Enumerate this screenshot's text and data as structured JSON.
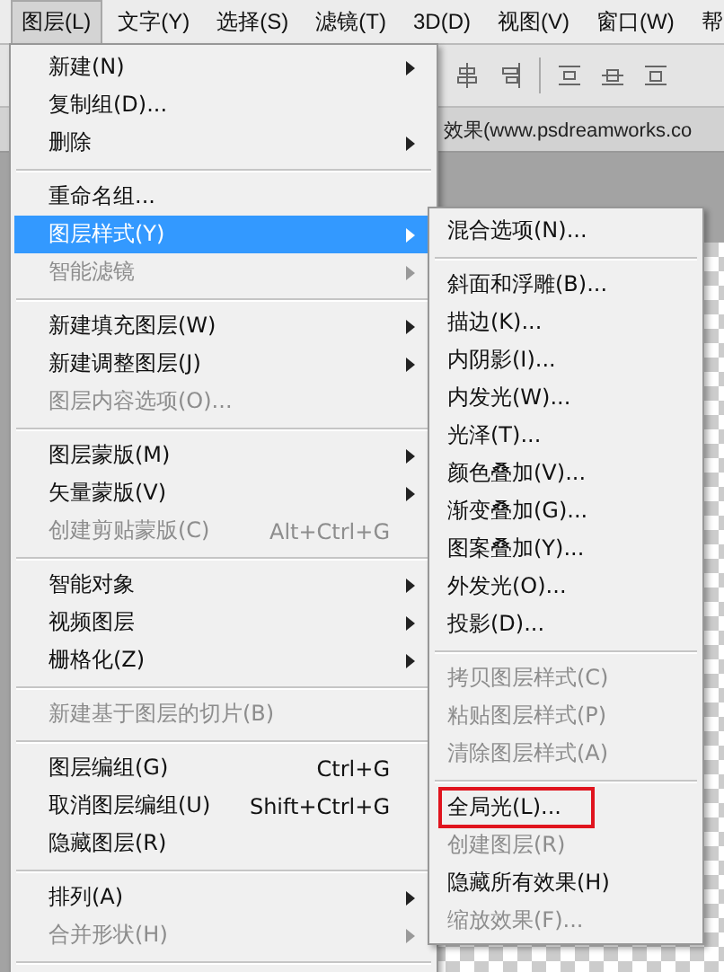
{
  "menubar": [
    {
      "label": "图层(L)",
      "selected": true
    },
    {
      "label": "文字(Y)",
      "selected": false
    },
    {
      "label": "选择(S)",
      "selected": false
    },
    {
      "label": "滤镜(T)",
      "selected": false
    },
    {
      "label": "3D(D)",
      "selected": false
    },
    {
      "label": "视图(V)",
      "selected": false
    },
    {
      "label": "窗口(W)",
      "selected": false
    },
    {
      "label": "帮",
      "selected": false
    }
  ],
  "document_tab": {
    "title": "效果(www.psdreamworks.co"
  },
  "menu": {
    "items": [
      {
        "kind": "item",
        "label": "新建(N)",
        "submenu": true,
        "disabled": false,
        "selected": false
      },
      {
        "kind": "item",
        "label": "复制组(D)...",
        "submenu": false,
        "disabled": false,
        "selected": false
      },
      {
        "kind": "item",
        "label": "删除",
        "submenu": true,
        "disabled": false,
        "selected": false
      },
      {
        "kind": "separator"
      },
      {
        "kind": "item",
        "label": "重命名组...",
        "submenu": false,
        "disabled": false,
        "selected": false
      },
      {
        "kind": "item",
        "label": "图层样式(Y)",
        "submenu": true,
        "disabled": false,
        "selected": true
      },
      {
        "kind": "item",
        "label": "智能滤镜",
        "submenu": true,
        "disabled": true,
        "selected": false
      },
      {
        "kind": "separator"
      },
      {
        "kind": "item",
        "label": "新建填充图层(W)",
        "submenu": true,
        "disabled": false,
        "selected": false
      },
      {
        "kind": "item",
        "label": "新建调整图层(J)",
        "submenu": true,
        "disabled": false,
        "selected": false
      },
      {
        "kind": "item",
        "label": "图层内容选项(O)...",
        "submenu": false,
        "disabled": true,
        "selected": false
      },
      {
        "kind": "separator"
      },
      {
        "kind": "item",
        "label": "图层蒙版(M)",
        "submenu": true,
        "disabled": false,
        "selected": false
      },
      {
        "kind": "item",
        "label": "矢量蒙版(V)",
        "submenu": true,
        "disabled": false,
        "selected": false
      },
      {
        "kind": "item",
        "label": "创建剪贴蒙版(C)",
        "shortcut": "Alt+Ctrl+G",
        "submenu": false,
        "disabled": true,
        "selected": false
      },
      {
        "kind": "separator"
      },
      {
        "kind": "item",
        "label": "智能对象",
        "submenu": true,
        "disabled": false,
        "selected": false
      },
      {
        "kind": "item",
        "label": "视频图层",
        "submenu": true,
        "disabled": false,
        "selected": false
      },
      {
        "kind": "item",
        "label": "栅格化(Z)",
        "submenu": true,
        "disabled": false,
        "selected": false
      },
      {
        "kind": "separator"
      },
      {
        "kind": "item",
        "label": "新建基于图层的切片(B)",
        "submenu": false,
        "disabled": true,
        "selected": false
      },
      {
        "kind": "separator"
      },
      {
        "kind": "item",
        "label": "图层编组(G)",
        "shortcut": "Ctrl+G",
        "submenu": false,
        "disabled": false,
        "selected": false
      },
      {
        "kind": "item",
        "label": "取消图层编组(U)",
        "shortcut": "Shift+Ctrl+G",
        "submenu": false,
        "disabled": false,
        "selected": false
      },
      {
        "kind": "item",
        "label": "隐藏图层(R)",
        "submenu": false,
        "disabled": false,
        "selected": false
      },
      {
        "kind": "separator"
      },
      {
        "kind": "item",
        "label": "排列(A)",
        "submenu": true,
        "disabled": false,
        "selected": false
      },
      {
        "kind": "item",
        "label": "合并形状(H)",
        "submenu": true,
        "disabled": true,
        "selected": false
      },
      {
        "kind": "separator"
      }
    ]
  },
  "submenu": {
    "items": [
      {
        "kind": "item",
        "label": "混合选项(N)...",
        "disabled": false,
        "outlined": false
      },
      {
        "kind": "separator"
      },
      {
        "kind": "item",
        "label": "斜面和浮雕(B)...",
        "disabled": false,
        "outlined": false
      },
      {
        "kind": "item",
        "label": "描边(K)...",
        "disabled": false,
        "outlined": false
      },
      {
        "kind": "item",
        "label": "内阴影(I)...",
        "disabled": false,
        "outlined": false
      },
      {
        "kind": "item",
        "label": "内发光(W)...",
        "disabled": false,
        "outlined": false
      },
      {
        "kind": "item",
        "label": "光泽(T)...",
        "disabled": false,
        "outlined": false
      },
      {
        "kind": "item",
        "label": "颜色叠加(V)...",
        "disabled": false,
        "outlined": false
      },
      {
        "kind": "item",
        "label": "渐变叠加(G)...",
        "disabled": false,
        "outlined": false
      },
      {
        "kind": "item",
        "label": "图案叠加(Y)...",
        "disabled": false,
        "outlined": false
      },
      {
        "kind": "item",
        "label": "外发光(O)...",
        "disabled": false,
        "outlined": false
      },
      {
        "kind": "item",
        "label": "投影(D)...",
        "disabled": false,
        "outlined": false
      },
      {
        "kind": "separator"
      },
      {
        "kind": "item",
        "label": "拷贝图层样式(C)",
        "disabled": true,
        "outlined": false
      },
      {
        "kind": "item",
        "label": "粘贴图层样式(P)",
        "disabled": true,
        "outlined": false
      },
      {
        "kind": "item",
        "label": "清除图层样式(A)",
        "disabled": true,
        "outlined": false
      },
      {
        "kind": "separator"
      },
      {
        "kind": "item",
        "label": "全局光(L)...",
        "disabled": false,
        "outlined": true
      },
      {
        "kind": "item",
        "label": "创建图层(R)",
        "disabled": true,
        "outlined": false
      },
      {
        "kind": "item",
        "label": "隐藏所有效果(H)",
        "disabled": false,
        "outlined": false
      },
      {
        "kind": "item",
        "label": "缩放效果(F)...",
        "disabled": true,
        "outlined": false
      }
    ]
  }
}
